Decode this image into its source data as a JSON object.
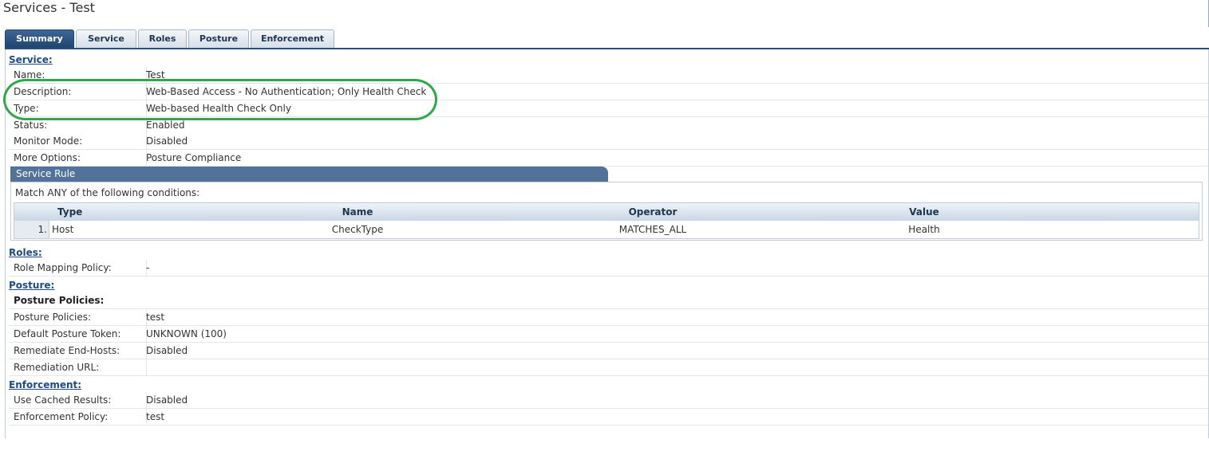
{
  "page": {
    "title": "Services - Test"
  },
  "tabs": [
    {
      "label": "Summary",
      "active": true
    },
    {
      "label": "Service"
    },
    {
      "label": "Roles"
    },
    {
      "label": "Posture"
    },
    {
      "label": "Enforcement"
    }
  ],
  "service": {
    "heading": "Service:",
    "rows": [
      {
        "key": "Name:",
        "value": "Test"
      },
      {
        "key": "Description:",
        "value": "Web-Based Access - No Authentication; Only Health Check"
      },
      {
        "key": "Type:",
        "value": "Web-based Health Check Only"
      },
      {
        "key": "Status:",
        "value": "Enabled"
      },
      {
        "key": "Monitor Mode:",
        "value": "Disabled"
      },
      {
        "key": "More Options:",
        "value": "Posture Compliance"
      }
    ]
  },
  "service_rule": {
    "title": "Service Rule",
    "caption": "Match ANY of the following conditions:",
    "columns": {
      "type": "Type",
      "name": "Name",
      "operator": "Operator",
      "value": "Value"
    },
    "rows": [
      {
        "num": "1.",
        "type": "Host",
        "name": "CheckType",
        "operator": "MATCHES_ALL",
        "value": "Health"
      }
    ]
  },
  "roles": {
    "heading": "Roles:",
    "rows": [
      {
        "key": "Role Mapping Policy:",
        "value": "-"
      }
    ]
  },
  "posture": {
    "heading": "Posture:",
    "subheading": "Posture Policies:",
    "rows": [
      {
        "key": "Posture Policies:",
        "value": "test"
      },
      {
        "key": "Default Posture Token:",
        "value": "UNKNOWN (100)"
      },
      {
        "key": "Remediate End-Hosts:",
        "value": "Disabled"
      },
      {
        "key": "Remediation URL:",
        "value": ""
      }
    ]
  },
  "enforcement": {
    "heading": "Enforcement:",
    "rows": [
      {
        "key": "Use Cached Results:",
        "value": "Disabled"
      },
      {
        "key": "Enforcement Policy:",
        "value": "test"
      }
    ]
  },
  "colors": {
    "accent": "#2b4f7e",
    "highlight": "#2fa84a",
    "heading_link": "#1e4a86"
  }
}
